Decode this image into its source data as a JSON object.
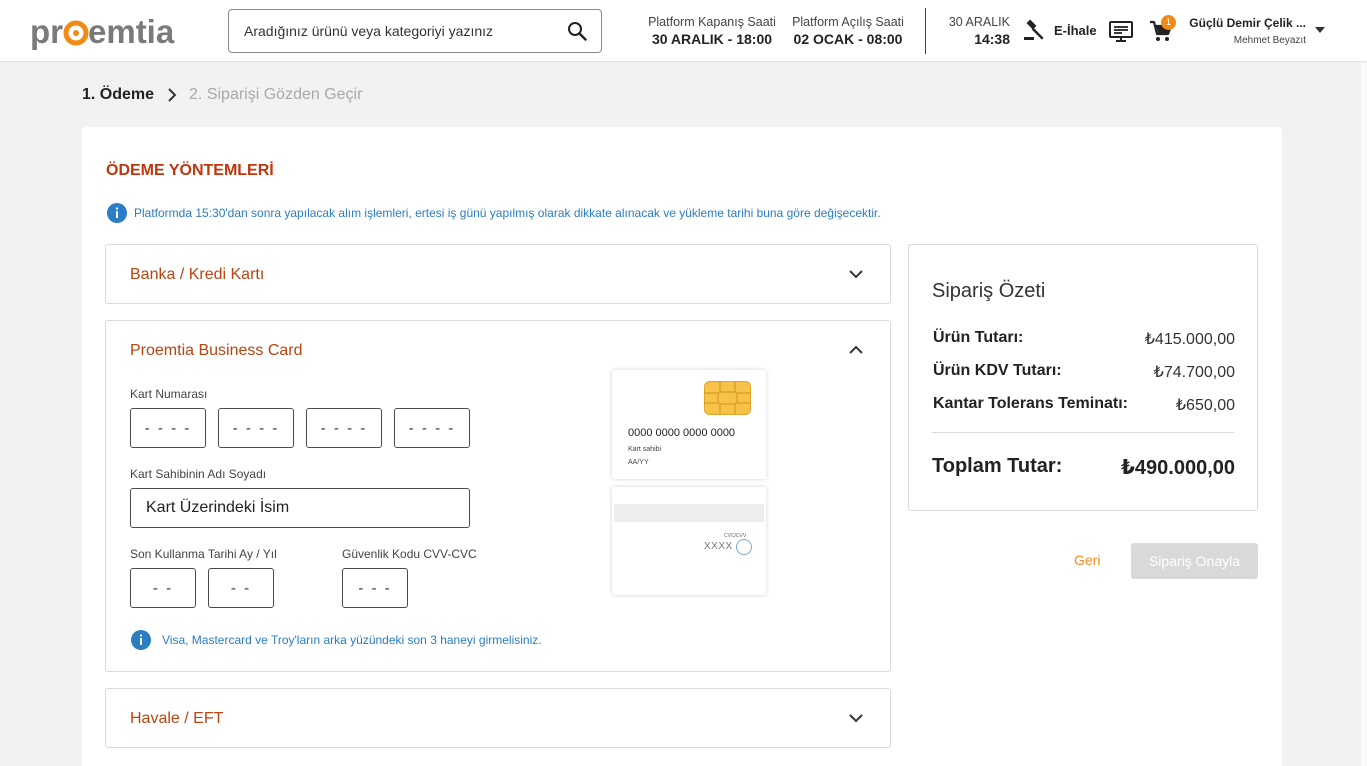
{
  "header": {
    "logo_text": "proemtia",
    "search_placeholder": "Aradığınız ürünü veya kategoriyi yazınız",
    "platform_close": {
      "label": "Platform Kapanış Saati",
      "value": "30 ARALIK - 18:00"
    },
    "platform_open": {
      "label": "Platform Açılış Saati",
      "value": "02 OCAK - 08:00"
    },
    "current_date": "30 ARALIK",
    "current_time": "14:38",
    "eihale_label": "E-İhale",
    "cart_count": "1",
    "company_name": "Güçlü Demir Çelik ...",
    "user_name": "Mehmet Beyazıt",
    "accent_color": "#f28b16"
  },
  "breadcrumb": {
    "step1": "1. Ödeme",
    "step2": "2. Siparişi Gözden Geçir"
  },
  "payment": {
    "title": "ÖDEME YÖNTEMLERİ",
    "info_note": "Platformda 15:30'dan sonra yapılacak alım işlemleri, ertesi iş günü yapılmış olarak dikkate alınacak ve yükleme tarihi buna göre değişecektir.",
    "methods": {
      "bank_card": "Banka / Kredi Kartı",
      "business_card": "Proemtia Business Card",
      "transfer": "Havale / EFT"
    },
    "form": {
      "card_number_label": "Kart Numarası",
      "card_number_placeholder": "- - - -",
      "holder_label": "Kart Sahibinin Adı Soyadı",
      "holder_value": "Kart Üzerindeki İsim",
      "expiry_label": "Son Kullanma Tarihi Ay / Yıl",
      "expiry_placeholder": "- -",
      "cvv_label": "Güvenlik Kodu CVV-CVC",
      "cvv_placeholder": "- - -",
      "cvv_note": "Visa, Mastercard ve Troy'ların arka yüzündeki son 3 haneyi girmelisiniz."
    },
    "card_preview": {
      "number": "0000 0000 0000 0000",
      "holder": "Kart sahibi",
      "expiry": "AA/YY",
      "cvv_label": "CVC/CVV",
      "cvv_value": "XXXX"
    }
  },
  "summary": {
    "title": "Sipariş Özeti",
    "rows": [
      {
        "label": "Ürün Tutarı:",
        "value": "₺415.000,00"
      },
      {
        "label": "Ürün KDV Tutarı:",
        "value": "₺74.700,00"
      },
      {
        "label": "Kantar Tolerans Teminatı:",
        "value": "₺650,00"
      }
    ],
    "total_label": "Toplam Tutar:",
    "total_value": "₺490.000,00"
  },
  "actions": {
    "back": "Geri",
    "confirm": "Sipariş Onayla"
  }
}
